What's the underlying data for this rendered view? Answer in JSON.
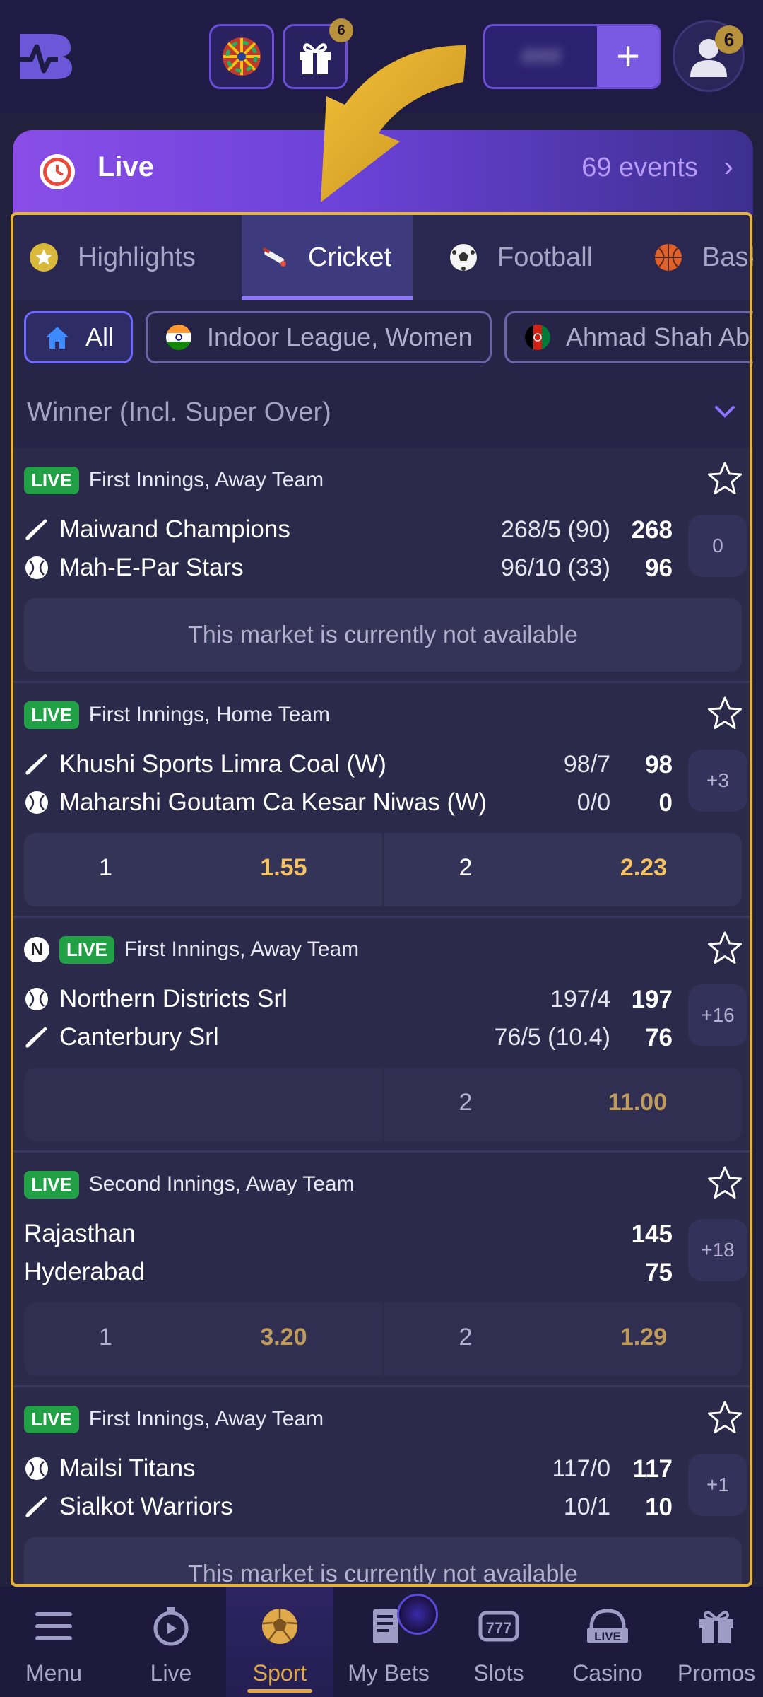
{
  "header": {
    "wheel_badge": "",
    "gift_badge": "6",
    "balance_text": "###",
    "plus_label": "+",
    "avatar_badge": "6"
  },
  "live_banner": {
    "title": "Live",
    "events_count": "69 events",
    "chevron": "›"
  },
  "sport_tabs": [
    {
      "label": "Highlights",
      "icon": "star-icon",
      "active": false
    },
    {
      "label": "Cricket",
      "icon": "cricket-bat-icon",
      "active": true
    },
    {
      "label": "Football",
      "icon": "football-icon",
      "active": false
    },
    {
      "label": "Bask",
      "icon": "basketball-icon",
      "active": false
    }
  ],
  "filter_chips": [
    {
      "label": "All",
      "icon": "home-icon",
      "active": true
    },
    {
      "label": "Indoor League, Women",
      "icon": "india-flag-icon",
      "active": false
    },
    {
      "label": "Ahmad Shah Ab",
      "icon": "afghanistan-flag-icon",
      "active": false
    }
  ],
  "market": {
    "label": "Winner (Incl. Super Over)"
  },
  "events": [
    {
      "live": "LIVE",
      "n_badge": "",
      "desc": "First Innings, Away Team",
      "teams": [
        {
          "name": "Maiwand Champions",
          "icon": "bat-icon",
          "detail": "268/5 (90)",
          "score": "268"
        },
        {
          "name": "Mah-E-Par Stars",
          "icon": "ball-icon",
          "detail": "96/10 (33)",
          "score": "96"
        }
      ],
      "more": "0",
      "unavailable": "This market is currently not available"
    },
    {
      "live": "LIVE",
      "n_badge": "",
      "desc": "First Innings, Home Team",
      "teams": [
        {
          "name": "Khushi Sports Limra Coal (W)",
          "icon": "bat-icon",
          "detail": "98/7",
          "score": "98"
        },
        {
          "name": "Maharshi Goutam Ca Kesar Niwas (W)",
          "icon": "ball-icon",
          "detail": "0/0",
          "score": "0"
        }
      ],
      "more": "+3",
      "odds": [
        {
          "name": "1",
          "value": "1.55"
        },
        {
          "name": "2",
          "value": "2.23"
        }
      ]
    },
    {
      "live": "LIVE",
      "n_badge": "N",
      "desc": "First Innings, Away Team",
      "teams": [
        {
          "name": "Northern Districts Srl",
          "icon": "ball-icon",
          "detail": "197/4",
          "score": "197"
        },
        {
          "name": "Canterbury Srl",
          "icon": "bat-icon",
          "detail": "76/5 (10.4)",
          "score": "76"
        }
      ],
      "more": "+16",
      "odds": [
        {
          "name": "",
          "value": ""
        },
        {
          "name": "2",
          "value": "11.00"
        }
      ]
    },
    {
      "live": "LIVE",
      "n_badge": "",
      "desc": "Second Innings, Away Team",
      "teams": [
        {
          "name": "Rajasthan",
          "icon": "",
          "detail": "",
          "score": "145"
        },
        {
          "name": "Hyderabad",
          "icon": "",
          "detail": "",
          "score": "75"
        }
      ],
      "more": "+18",
      "odds": [
        {
          "name": "1",
          "value": "3.20"
        },
        {
          "name": "2",
          "value": "1.29"
        }
      ]
    },
    {
      "live": "LIVE",
      "n_badge": "",
      "desc": "First Innings, Away Team",
      "teams": [
        {
          "name": "Mailsi Titans",
          "icon": "ball-icon",
          "detail": "117/0",
          "score": "117"
        },
        {
          "name": "Sialkot Warriors",
          "icon": "bat-icon",
          "detail": "10/1",
          "score": "10"
        }
      ],
      "more": "+1",
      "unavailable": "This market is currently not available"
    }
  ],
  "bottom_nav": [
    {
      "label": "Menu",
      "icon": "menu-icon",
      "active": false
    },
    {
      "label": "Live",
      "icon": "live-stopwatch-icon",
      "active": false
    },
    {
      "label": "Sport",
      "icon": "sport-ball-icon",
      "active": true
    },
    {
      "label": "My Bets",
      "icon": "bets-slip-icon",
      "active": false
    },
    {
      "label": "Slots",
      "icon": "slots-icon",
      "active": false
    },
    {
      "label": "Casino",
      "icon": "casino-live-icon",
      "active": false
    },
    {
      "label": "Promos",
      "icon": "gift-icon",
      "active": false
    }
  ],
  "colors": {
    "accent": "#7b5ae3",
    "live_green": "#21a045",
    "odds_gold": "#f5c366",
    "highlight_frame": "#e6b43a"
  }
}
